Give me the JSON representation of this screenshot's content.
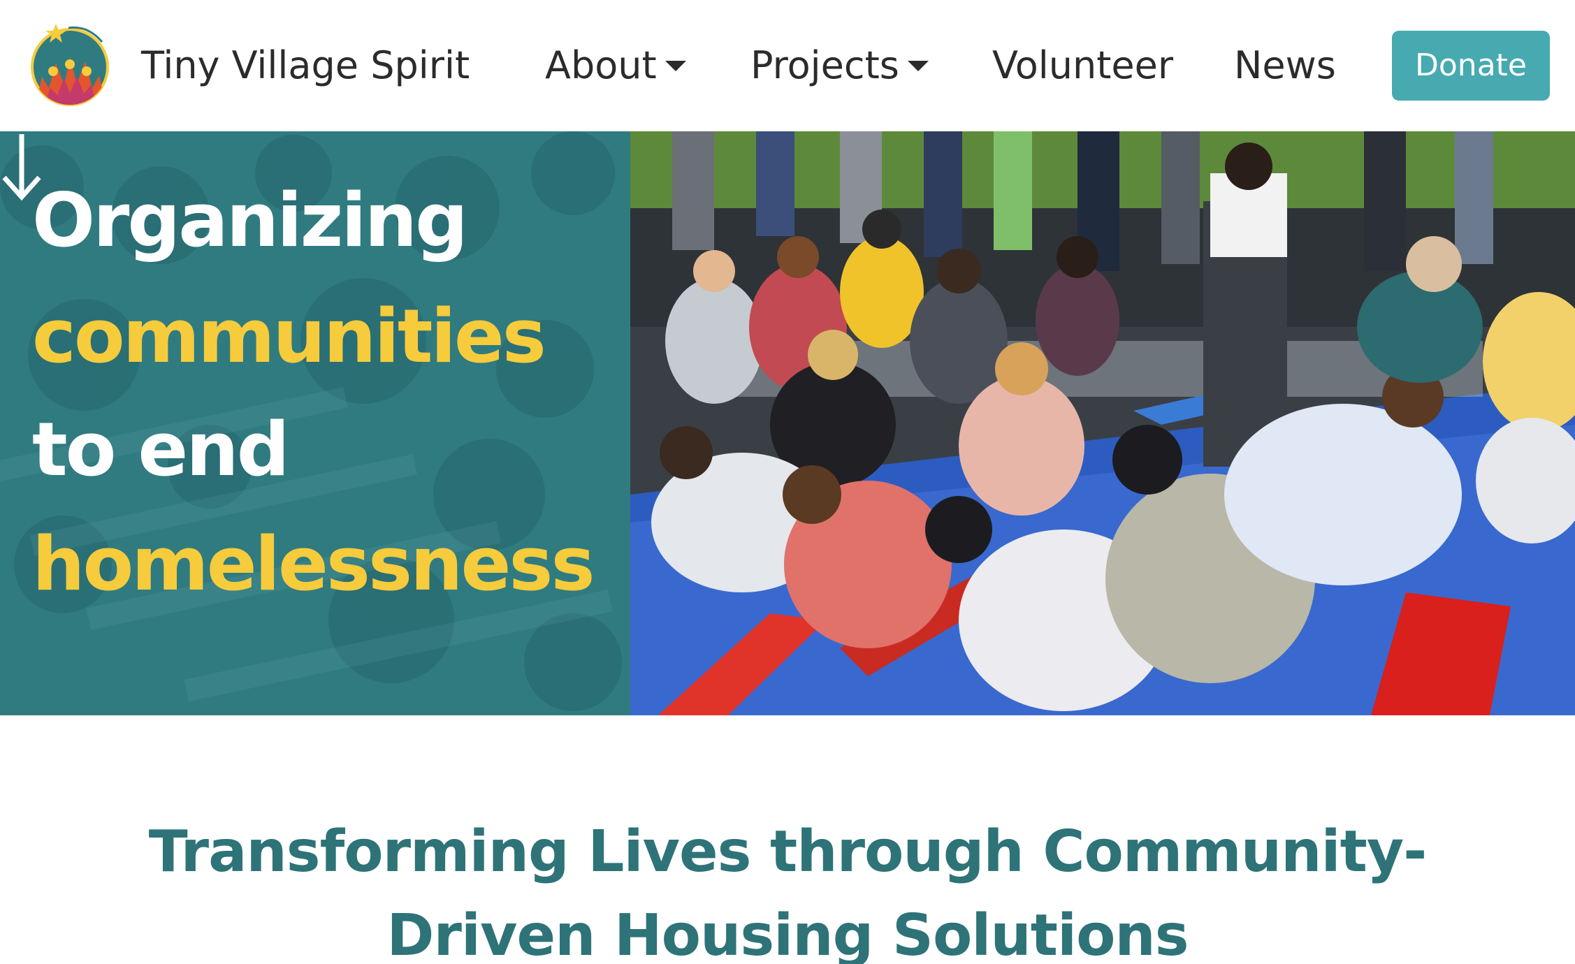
{
  "header": {
    "logo_icon": "tiny-village-spirit-logo",
    "site_name": "Tiny Village Spirit",
    "nav": {
      "about": "About",
      "projects": "Projects",
      "volunteer": "Volunteer",
      "news": "News"
    },
    "donate_label": "Donate"
  },
  "hero": {
    "line1": "Organizing",
    "line2": "communities",
    "line3": "to end",
    "line4": "homelessness",
    "arrow_icon": "arrow-down-icon",
    "photo": "volunteers painting boards outdoors"
  },
  "tagline": {
    "line1": "Transforming Lives through Community-",
    "line2": "Driven Housing Solutions"
  },
  "colors": {
    "teal_panel": "#2f7b80",
    "accent_yellow": "#f6cb3c",
    "donate_button": "#47aab0",
    "tagline_teal": "#2e7378",
    "nav_text": "#2b2b2b"
  }
}
